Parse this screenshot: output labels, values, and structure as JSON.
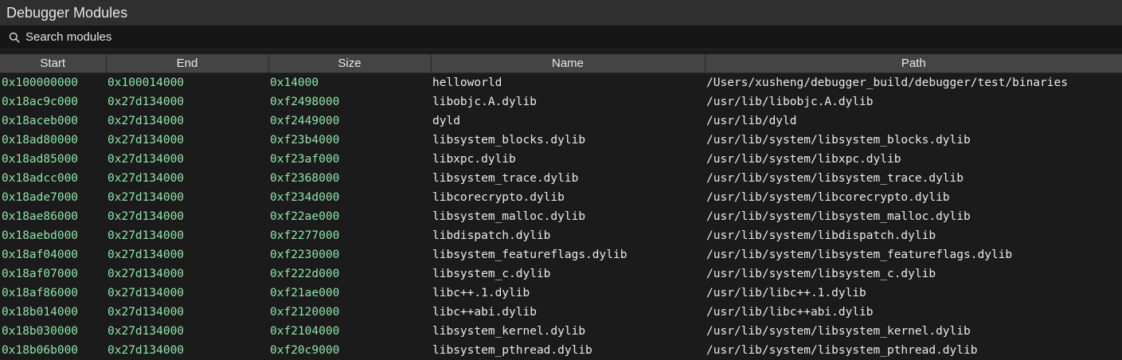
{
  "window": {
    "title": "Debugger Modules"
  },
  "search": {
    "placeholder": "Search modules",
    "value": ""
  },
  "icons": {
    "search": "search-icon"
  },
  "colors": {
    "address_text": "#8fe3a8",
    "header_bg": "#444444",
    "panel_bg": "#1b1b1b"
  },
  "table": {
    "columns": [
      "Start",
      "End",
      "Size",
      "Name",
      "Path"
    ],
    "rows": [
      {
        "start": "0x100000000",
        "end": "0x100014000",
        "size": "0x14000",
        "name": "helloworld",
        "path": "/Users/xusheng/debugger_build/debugger/test/binaries"
      },
      {
        "start": "0x18ac9c000",
        "end": "0x27d134000",
        "size": "0xf2498000",
        "name": "libobjc.A.dylib",
        "path": "/usr/lib/libobjc.A.dylib"
      },
      {
        "start": "0x18aceb000",
        "end": "0x27d134000",
        "size": "0xf2449000",
        "name": "dyld",
        "path": "/usr/lib/dyld"
      },
      {
        "start": "0x18ad80000",
        "end": "0x27d134000",
        "size": "0xf23b4000",
        "name": "libsystem_blocks.dylib",
        "path": "/usr/lib/system/libsystem_blocks.dylib"
      },
      {
        "start": "0x18ad85000",
        "end": "0x27d134000",
        "size": "0xf23af000",
        "name": "libxpc.dylib",
        "path": "/usr/lib/system/libxpc.dylib"
      },
      {
        "start": "0x18adcc000",
        "end": "0x27d134000",
        "size": "0xf2368000",
        "name": "libsystem_trace.dylib",
        "path": "/usr/lib/system/libsystem_trace.dylib"
      },
      {
        "start": "0x18ade7000",
        "end": "0x27d134000",
        "size": "0xf234d000",
        "name": "libcorecrypto.dylib",
        "path": "/usr/lib/system/libcorecrypto.dylib"
      },
      {
        "start": "0x18ae86000",
        "end": "0x27d134000",
        "size": "0xf22ae000",
        "name": "libsystem_malloc.dylib",
        "path": "/usr/lib/system/libsystem_malloc.dylib"
      },
      {
        "start": "0x18aebd000",
        "end": "0x27d134000",
        "size": "0xf2277000",
        "name": "libdispatch.dylib",
        "path": "/usr/lib/system/libdispatch.dylib"
      },
      {
        "start": "0x18af04000",
        "end": "0x27d134000",
        "size": "0xf2230000",
        "name": "libsystem_featureflags.dylib",
        "path": "/usr/lib/system/libsystem_featureflags.dylib"
      },
      {
        "start": "0x18af07000",
        "end": "0x27d134000",
        "size": "0xf222d000",
        "name": "libsystem_c.dylib",
        "path": "/usr/lib/system/libsystem_c.dylib"
      },
      {
        "start": "0x18af86000",
        "end": "0x27d134000",
        "size": "0xf21ae000",
        "name": "libc++.1.dylib",
        "path": "/usr/lib/libc++.1.dylib"
      },
      {
        "start": "0x18b014000",
        "end": "0x27d134000",
        "size": "0xf2120000",
        "name": "libc++abi.dylib",
        "path": "/usr/lib/libc++abi.dylib"
      },
      {
        "start": "0x18b030000",
        "end": "0x27d134000",
        "size": "0xf2104000",
        "name": "libsystem_kernel.dylib",
        "path": "/usr/lib/system/libsystem_kernel.dylib"
      },
      {
        "start": "0x18b06b000",
        "end": "0x27d134000",
        "size": "0xf20c9000",
        "name": "libsystem_pthread.dylib",
        "path": "/usr/lib/system/libsystem_pthread.dylib"
      }
    ]
  }
}
